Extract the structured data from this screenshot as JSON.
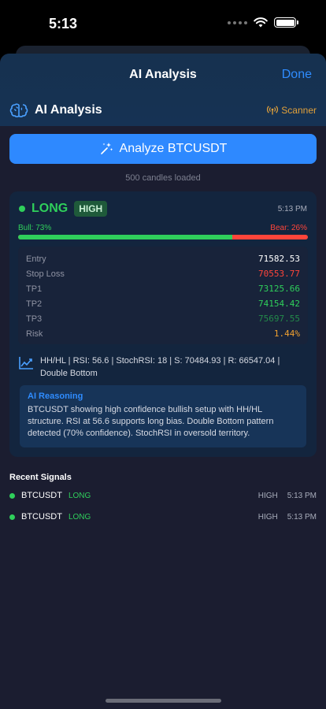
{
  "status_bar": {
    "time": "5:13"
  },
  "sheet": {
    "title": "AI Analysis",
    "done_label": "Done"
  },
  "ai_header": {
    "label": "AI Analysis",
    "scanner_label": "Scanner"
  },
  "analyze": {
    "label": "Analyze BTCUSDT",
    "candles_loaded": "500 candles loaded"
  },
  "signal": {
    "direction": "LONG",
    "confidence": "HIGH",
    "time": "5:13 PM",
    "bull_label": "Bull: 73%",
    "bear_label": "Bear: 26%",
    "bull_fraction": 0.74,
    "levels": [
      {
        "name": "Entry",
        "value": "71582.53",
        "color": "#ffffff"
      },
      {
        "name": "Stop Loss",
        "value": "70553.77",
        "color": "#ff453a"
      },
      {
        "name": "TP1",
        "value": "73125.66",
        "color": "#2fcf5b"
      },
      {
        "name": "TP2",
        "value": "74154.42",
        "color": "#2fcf5b"
      },
      {
        "name": "TP3",
        "value": "75697.55",
        "color": "#238a4a"
      },
      {
        "name": "Risk",
        "value": "1.44%",
        "color": "#f0a030"
      }
    ],
    "patterns": "HH/HL | RSI: 56.6 | StochRSI: 18 | S: 70484.93 | R: 66547.04 | Double Bottom",
    "reasoning_title": "AI Reasoning",
    "reasoning_text": "BTCUSDT showing high confidence bullish setup with HH/HL structure. RSI at 56.6 supports long bias. Double Bottom pattern detected (70% confidence). StochRSI in oversold territory."
  },
  "recent": {
    "title": "Recent Signals",
    "items": [
      {
        "symbol": "BTCUSDT",
        "direction": "LONG",
        "confidence": "HIGH",
        "time": "5:13 PM"
      },
      {
        "symbol": "BTCUSDT",
        "direction": "LONG",
        "confidence": "HIGH",
        "time": "5:13 PM"
      }
    ]
  },
  "colors": {
    "accent": "#2e89ff",
    "bull": "#2fcf5b",
    "bear": "#ff453a",
    "scanner": "#e2a13a"
  }
}
